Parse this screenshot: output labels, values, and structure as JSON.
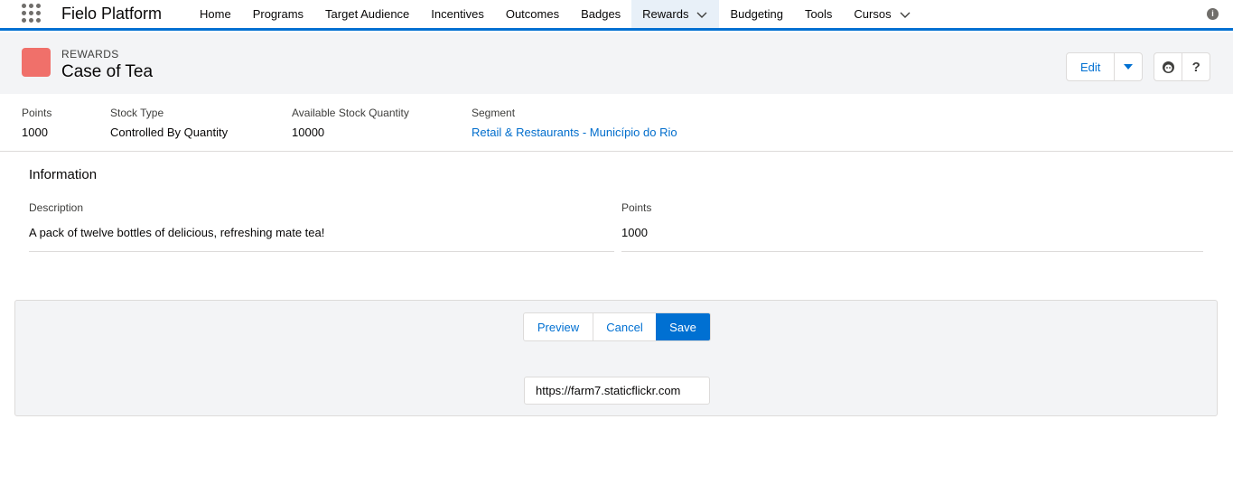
{
  "app": {
    "name": "Fielo Platform"
  },
  "nav": {
    "items": [
      {
        "label": "Home",
        "active": false,
        "dropdown": false
      },
      {
        "label": "Programs",
        "active": false,
        "dropdown": false
      },
      {
        "label": "Target Audience",
        "active": false,
        "dropdown": false
      },
      {
        "label": "Incentives",
        "active": false,
        "dropdown": false
      },
      {
        "label": "Outcomes",
        "active": false,
        "dropdown": false
      },
      {
        "label": "Badges",
        "active": false,
        "dropdown": false
      },
      {
        "label": "Rewards",
        "active": true,
        "dropdown": true
      },
      {
        "label": "Budgeting",
        "active": false,
        "dropdown": false
      },
      {
        "label": "Tools",
        "active": false,
        "dropdown": false
      },
      {
        "label": "Cursos",
        "active": false,
        "dropdown": true
      }
    ],
    "info_icon": "i"
  },
  "record": {
    "object_type": "REWARDS",
    "title": "Case of Tea",
    "icon_color": "#f0706a",
    "edit_label": "Edit",
    "help_label": "?"
  },
  "highlights": [
    {
      "label": "Points",
      "value": "1000"
    },
    {
      "label": "Stock Type",
      "value": "Controlled By Quantity"
    },
    {
      "label": "Available Stock Quantity",
      "value": "10000"
    },
    {
      "label": "Segment",
      "value": "Retail & Restaurants - Município do Rio"
    }
  ],
  "information": {
    "title": "Information",
    "description_label": "Description",
    "description_value": "A pack of twelve bottles of delicious, refreshing mate tea!",
    "points_label": "Points",
    "points_value": "1000"
  },
  "editor": {
    "preview_label": "Preview",
    "cancel_label": "Cancel",
    "save_label": "Save",
    "url_value": "https://farm7.staticflickr.com"
  },
  "colors": {
    "brand": "#0070d2",
    "link": "#006dcc",
    "header_bg": "#f3f4f6"
  }
}
